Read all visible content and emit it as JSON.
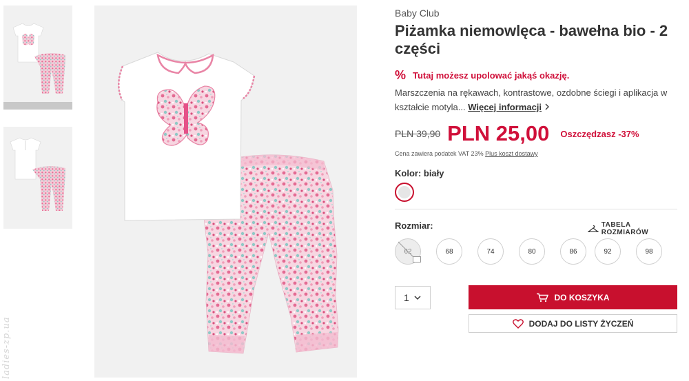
{
  "watermark": "ladies-zp.ua",
  "product": {
    "brand": "Baby Club",
    "title": "Piżamka niemowlęca - bawełna bio - 2 części",
    "promo_icon": "%",
    "promo_text": "Tutaj możesz upolować jakąś okazję.",
    "description": "Marszczenia na rękawach, kontrastowe, ozdobne ściegi i aplikacja w kształcie motyla...",
    "more_info": "Więcej informacji",
    "old_price": "PLN 39,90",
    "new_price": "PLN 25,00",
    "savings": "Oszczędzasz -37%",
    "vat_text": "Cena zawiera podatek VAT 23%",
    "shipping_link": "Plus koszt dostawy",
    "color_label": "Kolor: biały",
    "size_label": "Rozmiar:",
    "size_table": "TABELA ROZMIARÓW",
    "sizes": [
      "62",
      "68",
      "74",
      "80",
      "86",
      "92",
      "98"
    ],
    "quantity": "1",
    "add_to_cart": "DO KOSZYKA",
    "add_to_wishlist": "DODAJ DO LISTY ŻYCZEŃ"
  },
  "colors": {
    "accent": "#c8102e",
    "price": "#d0103a",
    "pattern_pink": "#e985a6",
    "pattern_teal": "#8fc9c6"
  },
  "icons": [
    "cart-icon",
    "heart-icon",
    "hanger-icon",
    "chevron-down-icon",
    "chevron-right-icon",
    "percent-icon",
    "mail-icon"
  ]
}
